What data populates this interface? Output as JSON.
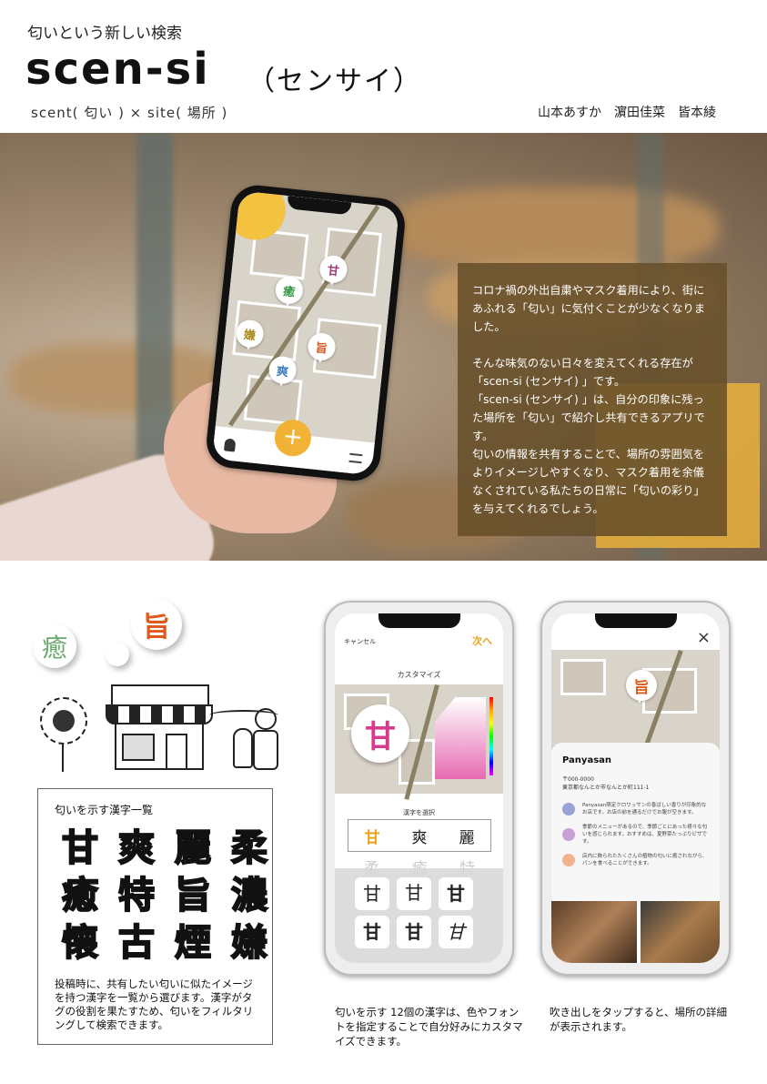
{
  "header": {
    "kicker": "匂いという新しい検索",
    "logo": "scen-si",
    "logo_ruby": "（センサイ）",
    "subline": "scent( 匂い ) × site( 場所 )",
    "authors": "山本あすか　濵田佳菜　皆本綾"
  },
  "hero_phone": {
    "pins": [
      {
        "char": "甘",
        "color": "#9b3f7a"
      },
      {
        "char": "癒",
        "color": "#3c9a4a"
      },
      {
        "char": "嫌",
        "color": "#a88a1a"
      },
      {
        "char": "旨",
        "color": "#d9531e"
      },
      {
        "char": "爽",
        "color": "#3a7dbb"
      }
    ],
    "fab": "+"
  },
  "intro": {
    "p1": "コロナ禍の外出自粛やマスク着用により、街にあふれる「匂い」に気付くことが少なくなりました。",
    "p2a": "そんな味気のない日々を変えてくれる存在が「scen-si (センサイ) 」です。",
    "p2b": "「scen-si (センサイ) 」は、自分の印象に残った場所を「匂い」で紹介し共有できるアプリです。",
    "p2c": "匂いの情報を共有することで、場所の雰囲気をよりイメージしやすくなり、マスク着用を余儀なくされている私たちの日常に「匂いの彩り」を与えてくれるでしょう。"
  },
  "illustration": {
    "bubble1": "癒",
    "bubble2": "旨"
  },
  "kanji_list": {
    "title": "匂いを示す漢字一覧",
    "chars": [
      "甘",
      "爽",
      "麗",
      "柔",
      "癒",
      "特",
      "旨",
      "濃",
      "懐",
      "古",
      "煙",
      "嫌"
    ],
    "desc": "投稿時に、共有したい匂いに似たイメージを持つ漢字を一覧から選びます。漢字がタグの役割を果たすため、匂いをフィルタリングして検索できます。"
  },
  "customize_phone": {
    "cancel": "キャンセル",
    "next": "次へ",
    "title": "カスタマイズ",
    "preview_char": "甘",
    "select_label": "漢字を選択",
    "picker": [
      "甘",
      "爽",
      "麗"
    ],
    "faded": [
      "柔",
      "癒",
      "特"
    ],
    "fonts": [
      "甘",
      "甘",
      "甘",
      "甘",
      "甘",
      "甘"
    ],
    "caption": "匂いを示す 12個の漢字は、色やフォントを指定することで自分好みにカスタマイズできます。"
  },
  "detail_phone": {
    "close": "×",
    "pin": "旨",
    "shop_name": "Panyasan",
    "address1": "〒000-0000",
    "address2": "東京都なんとか市なんとか町111-1",
    "comments": [
      {
        "color": "#9aa3d6",
        "text": "Panyasan限定クロワッサンの香ばしい香りが印象的なお店です。お店の前を通るだけでお腹が空きます。"
      },
      {
        "color": "#c8a0d6",
        "text": "季節のメニューがあるので、季節ごとにあった様々な匂いを感じられます。おすすめは、夏野菜たっぷりピザです。"
      },
      {
        "color": "#f2b28c",
        "text": "店内に飾られたたくさんの植物の匂いに癒されながら、パンを食べることができます。"
      }
    ],
    "caption": "吹き出しをタップすると、場所の詳細が表示されます。"
  }
}
